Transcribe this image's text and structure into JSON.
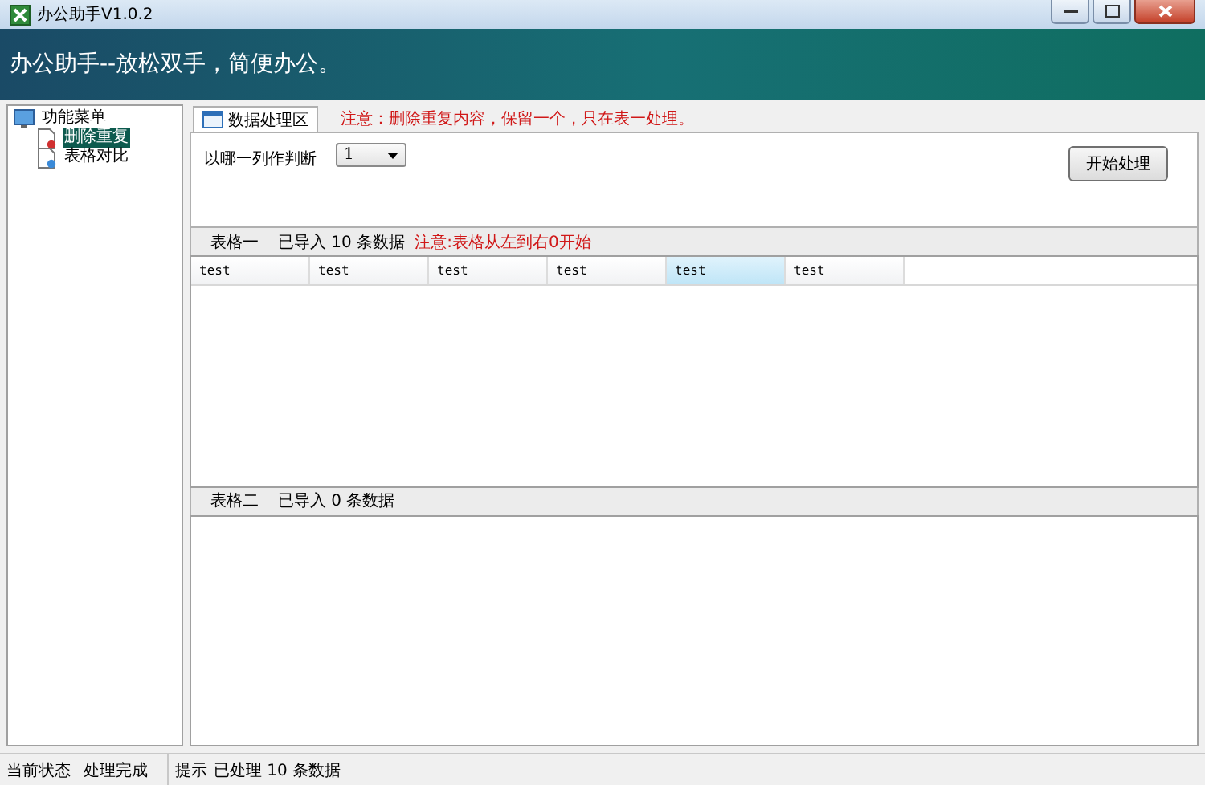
{
  "window": {
    "title": "办公助手V1.0.2"
  },
  "banner": {
    "text": "办公助手--放松双手，简便办公。"
  },
  "sidebar": {
    "tree": [
      {
        "label": "功能菜单",
        "expanded": true,
        "children": [
          {
            "label": "删除重复",
            "selected": true
          },
          {
            "label": "表格对比",
            "selected": false
          }
        ]
      }
    ]
  },
  "tab": {
    "label": "数据处理区",
    "selected": true
  },
  "notice": "注意：删除重复内容，保留一个，只在表一处理。",
  "controls": {
    "label": "以哪一列作判断",
    "column_select": {
      "value": "1"
    },
    "start_button": "开始处理"
  },
  "table_one": {
    "title": "表格一",
    "summary": "已导入 10 条数据",
    "note": "注意:表格从左到右0开始",
    "columns": [
      {
        "label": "test",
        "selected": false
      },
      {
        "label": "test",
        "selected": false
      },
      {
        "label": "test",
        "selected": false
      },
      {
        "label": "test",
        "selected": false
      },
      {
        "label": "test",
        "selected": true
      },
      {
        "label": "test",
        "selected": false
      }
    ]
  },
  "table_two": {
    "title": "表格二",
    "summary": "已导入 0 条数据"
  },
  "status_bar": {
    "state_label": "当前状态",
    "state_value": "处理完成",
    "hint_label": "提示",
    "hint_value": "已处理 10 条数据"
  }
}
